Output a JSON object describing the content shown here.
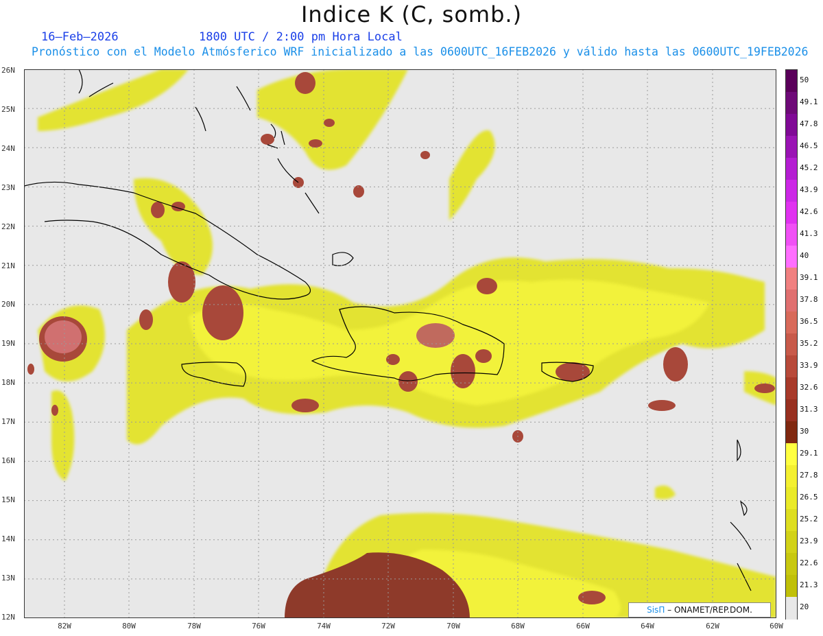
{
  "header": {
    "title": "Indice K (C, somb.)",
    "date": "16–Feb–2026",
    "time": "1800 UTC / 2:00 pm Hora Local",
    "subtitle": "Pronóstico con el Modelo Atmósferico WRF inicializado a las 0600UTC_16FEB2026 y válido hasta las  0600UTC_19FEB2026"
  },
  "map": {
    "background": "#e8e8e8",
    "lat_labels": [
      "26N",
      "25N",
      "24N",
      "23N",
      "22N",
      "21N",
      "20N",
      "19N",
      "18N",
      "17N",
      "16N",
      "15N",
      "14N",
      "13N",
      "12N"
    ],
    "lon_labels": [
      "82W",
      "80W",
      "78W",
      "76W",
      "74W",
      "72W",
      "70W",
      "68W",
      "66W",
      "64W",
      "62W",
      "60W"
    ],
    "lat_range": [
      12,
      26
    ],
    "lon_range": [
      -83.2,
      -60
    ]
  },
  "legend": {
    "labels": [
      "50",
      "49.1",
      "47.8",
      "46.5",
      "45.2",
      "43.9",
      "42.6",
      "41.3",
      "40",
      "39.1",
      "37.8",
      "36.5",
      "35.2",
      "33.9",
      "32.6",
      "31.3",
      "30",
      "29.1",
      "27.8",
      "26.5",
      "25.2",
      "23.9",
      "22.6",
      "21.3",
      "20"
    ],
    "colors": [
      "#5a005a",
      "#6e0a78",
      "#800a96",
      "#9a14b4",
      "#b41ed2",
      "#cc28e6",
      "#e032f0",
      "#f050f5",
      "#ff6eff",
      "#f08080",
      "#e07070",
      "#d86a5a",
      "#c85a4a",
      "#b84a3a",
      "#a83a2a",
      "#983020",
      "#802810",
      "#ffff40",
      "#f4f030",
      "#eaea28",
      "#dede20",
      "#d2d218",
      "#c8c810",
      "#c0c008",
      "#e8e8e8"
    ]
  },
  "credit": {
    "brand": "SisΠ",
    "text": "– ONAMET/REP.DOM."
  }
}
